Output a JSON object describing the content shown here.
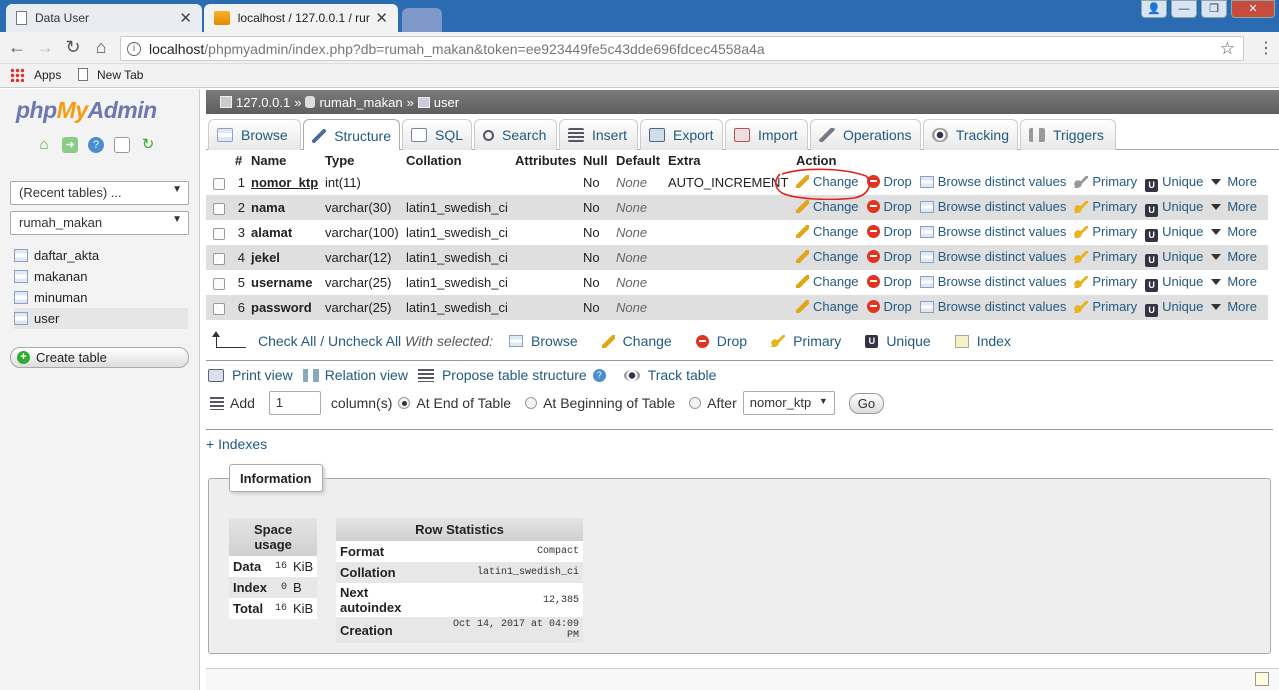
{
  "browser": {
    "tabs": [
      {
        "title": "Data User"
      },
      {
        "title": "localhost / 127.0.0.1 / rur"
      }
    ],
    "url_host": "localhost",
    "url_rest": "/phpmyadmin/index.php?db=rumah_makan&token=ee923449fe5c43dde696fdcec4558a4a",
    "bookmarks": [
      "Apps",
      "New Tab"
    ]
  },
  "sidebar": {
    "logo": {
      "php": "php",
      "my": "My",
      "admin": "Admin"
    },
    "recent": "(Recent tables) ...",
    "database": "rumah_makan",
    "tables": [
      "daftar_akta",
      "makanan",
      "minuman",
      "user"
    ],
    "create_table": "Create table"
  },
  "breadcrumb": {
    "server": "127.0.0.1",
    "database": "rumah_makan",
    "table": "user"
  },
  "tabs": [
    "Browse",
    "Structure",
    "SQL",
    "Search",
    "Insert",
    "Export",
    "Import",
    "Operations",
    "Tracking",
    "Triggers"
  ],
  "structure": {
    "headers": [
      "#",
      "Name",
      "Type",
      "Collation",
      "Attributes",
      "Null",
      "Default",
      "Extra",
      "Action"
    ],
    "rows": [
      {
        "num": "1",
        "name": "nomor_ktp",
        "type": "int(11)",
        "collation": "",
        "attributes": "",
        "null": "No",
        "default": "None",
        "extra": "AUTO_INCREMENT"
      },
      {
        "num": "2",
        "name": "nama",
        "type": "varchar(30)",
        "collation": "latin1_swedish_ci",
        "attributes": "",
        "null": "No",
        "default": "None",
        "extra": ""
      },
      {
        "num": "3",
        "name": "alamat",
        "type": "varchar(100)",
        "collation": "latin1_swedish_ci",
        "attributes": "",
        "null": "No",
        "default": "None",
        "extra": ""
      },
      {
        "num": "4",
        "name": "jekel",
        "type": "varchar(12)",
        "collation": "latin1_swedish_ci",
        "attributes": "",
        "null": "No",
        "default": "None",
        "extra": ""
      },
      {
        "num": "5",
        "name": "username",
        "type": "varchar(25)",
        "collation": "latin1_swedish_ci",
        "attributes": "",
        "null": "No",
        "default": "None",
        "extra": ""
      },
      {
        "num": "6",
        "name": "password",
        "type": "varchar(25)",
        "collation": "latin1_swedish_ci",
        "attributes": "",
        "null": "No",
        "default": "None",
        "extra": ""
      }
    ],
    "actions": {
      "change": "Change",
      "drop": "Drop",
      "browse": "Browse distinct values",
      "primary": "Primary",
      "unique": "Unique",
      "more": "More"
    }
  },
  "with_selected": {
    "check_all": "Check All / Uncheck All",
    "label": "With selected:",
    "items": [
      "Browse",
      "Change",
      "Drop",
      "Primary",
      "Unique",
      "Index"
    ]
  },
  "view_links": {
    "print": "Print view",
    "relation": "Relation view",
    "propose": "Propose table structure",
    "track": "Track table"
  },
  "add_columns": {
    "add": "Add",
    "count": "1",
    "columns": "column(s)",
    "at_end": "At End of Table",
    "at_beginning": "At Beginning of Table",
    "after": "After",
    "after_field": "nomor_ktp",
    "go": "Go"
  },
  "indexes_link": "+ Indexes",
  "information": {
    "legend": "Information",
    "space_usage": {
      "header_line1": "Space",
      "header_line2": "usage",
      "rows": [
        {
          "label": "Data",
          "value": "16",
          "unit": "KiB"
        },
        {
          "label": "Index",
          "value": "0",
          "unit": "B"
        },
        {
          "label": "Total",
          "value": "16",
          "unit": "KiB"
        }
      ]
    },
    "row_statistics": {
      "header": "Row Statistics",
      "rows": [
        {
          "label": "Format",
          "value": "Compact"
        },
        {
          "label": "Collation",
          "value": "latin1_swedish_ci"
        },
        {
          "label": "Next autoindex",
          "value": "12,385"
        },
        {
          "label": "Creation",
          "value": "Oct 14, 2017 at 04:09 PM"
        }
      ]
    }
  }
}
